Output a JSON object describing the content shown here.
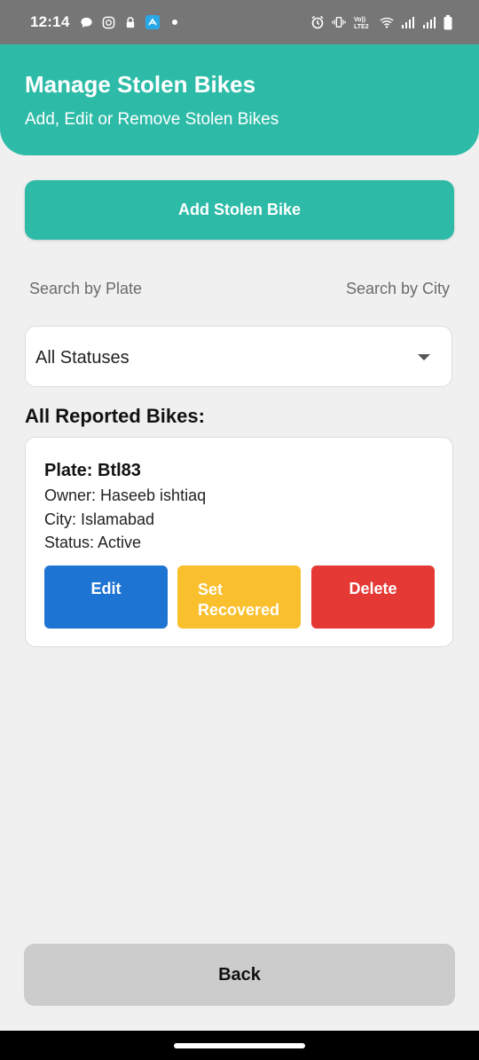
{
  "status_bar": {
    "time": "12:14",
    "volte_label": "Vo)) LTE2"
  },
  "header": {
    "title": "Manage Stolen Bikes",
    "subtitle": "Add, Edit or Remove Stolen Bikes"
  },
  "add_button": {
    "label": "Add Stolen Bike"
  },
  "search": {
    "plate_placeholder": "Search by Plate",
    "city_placeholder": "Search by City"
  },
  "status_filter": {
    "selected": "All Statuses"
  },
  "section": {
    "title": "All Reported Bikes:"
  },
  "bikes": [
    {
      "plate": "Plate: Btl83",
      "owner": "Owner: Haseeb ishtiaq",
      "city": "City: Islamabad",
      "status": "Status: Active",
      "actions": {
        "edit": "Edit",
        "recover": "Set Recovered",
        "delete": "Delete"
      }
    }
  ],
  "back_button": {
    "label": "Back"
  },
  "colors": {
    "accent": "#2dbba8",
    "edit": "#1e74d2",
    "recover": "#f9bf2c",
    "delete": "#e53935",
    "back": "#cccccc"
  }
}
